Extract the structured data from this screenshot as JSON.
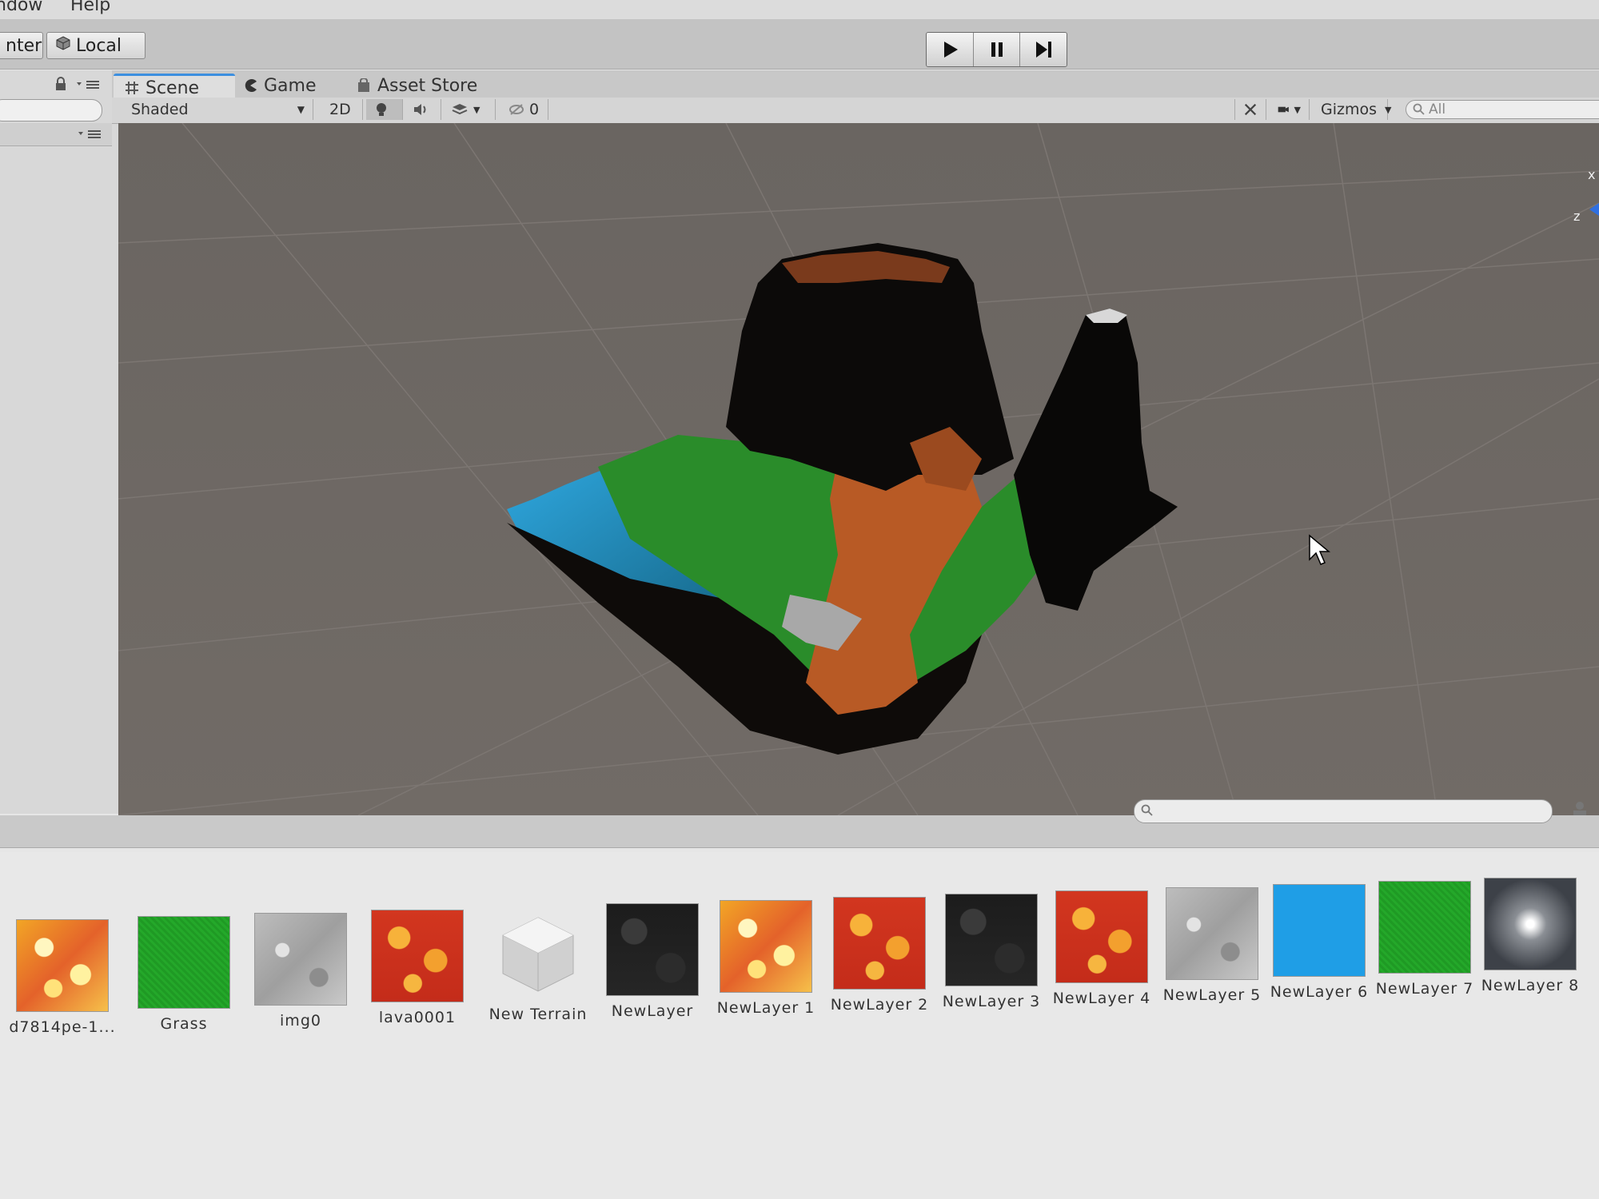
{
  "menu": {
    "window": "ndow",
    "help": "Help"
  },
  "toolbar": {
    "pivot_label": "nter",
    "local_label": "Local"
  },
  "tabs": [
    {
      "label": "Scene",
      "icon": "scene-grid-icon"
    },
    {
      "label": "Game",
      "icon": "game-pacman-icon"
    },
    {
      "label": "Asset Store",
      "icon": "store-bag-icon"
    }
  ],
  "scene_toolbar": {
    "draw_mode": "Shaded",
    "mode_2d": "2D",
    "hidden_count": "0",
    "gizmos": "Gizmos",
    "search_placeholder": "All"
  },
  "gizmo_axes": {
    "x": "x",
    "z": "z"
  },
  "assets": [
    {
      "label": "d7814pe-1...",
      "texture": "fire"
    },
    {
      "label": "Grass",
      "texture": "green"
    },
    {
      "label": "img0",
      "texture": "rock"
    },
    {
      "label": "lava0001",
      "texture": "lava"
    },
    {
      "label": "New Terrain",
      "texture": "terrain-cube"
    },
    {
      "label": "NewLayer",
      "texture": "dark"
    },
    {
      "label": "NewLayer 1",
      "texture": "fire"
    },
    {
      "label": "NewLayer 2",
      "texture": "lava"
    },
    {
      "label": "NewLayer 3",
      "texture": "dark"
    },
    {
      "label": "NewLayer 4",
      "texture": "lava"
    },
    {
      "label": "NewLayer 5",
      "texture": "rock"
    },
    {
      "label": "NewLayer 6",
      "texture": "blue"
    },
    {
      "label": "NewLayer 7",
      "texture": "green"
    },
    {
      "label": "NewLayer 8",
      "texture": "glow"
    }
  ]
}
